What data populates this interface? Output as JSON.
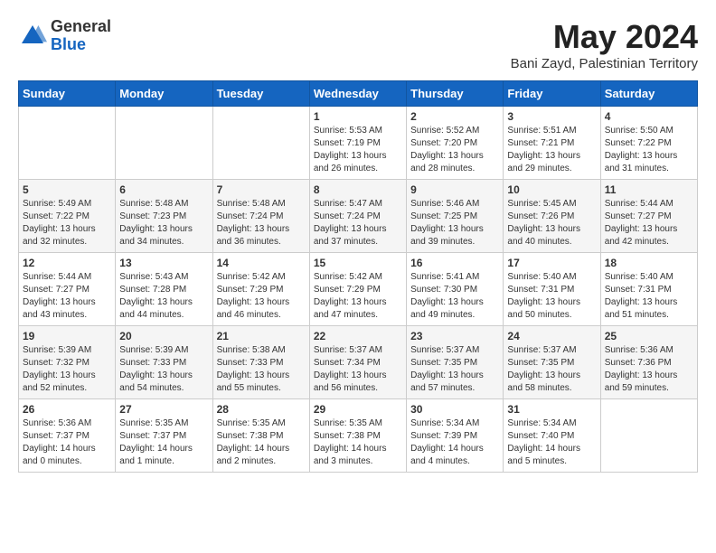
{
  "logo": {
    "general": "General",
    "blue": "Blue"
  },
  "title": "May 2024",
  "location": "Bani Zayd, Palestinian Territory",
  "days_of_week": [
    "Sunday",
    "Monday",
    "Tuesday",
    "Wednesday",
    "Thursday",
    "Friday",
    "Saturday"
  ],
  "weeks": [
    [
      {
        "day": "",
        "info": ""
      },
      {
        "day": "",
        "info": ""
      },
      {
        "day": "",
        "info": ""
      },
      {
        "day": "1",
        "info": "Sunrise: 5:53 AM\nSunset: 7:19 PM\nDaylight: 13 hours\nand 26 minutes."
      },
      {
        "day": "2",
        "info": "Sunrise: 5:52 AM\nSunset: 7:20 PM\nDaylight: 13 hours\nand 28 minutes."
      },
      {
        "day": "3",
        "info": "Sunrise: 5:51 AM\nSunset: 7:21 PM\nDaylight: 13 hours\nand 29 minutes."
      },
      {
        "day": "4",
        "info": "Sunrise: 5:50 AM\nSunset: 7:22 PM\nDaylight: 13 hours\nand 31 minutes."
      }
    ],
    [
      {
        "day": "5",
        "info": "Sunrise: 5:49 AM\nSunset: 7:22 PM\nDaylight: 13 hours\nand 32 minutes."
      },
      {
        "day": "6",
        "info": "Sunrise: 5:48 AM\nSunset: 7:23 PM\nDaylight: 13 hours\nand 34 minutes."
      },
      {
        "day": "7",
        "info": "Sunrise: 5:48 AM\nSunset: 7:24 PM\nDaylight: 13 hours\nand 36 minutes."
      },
      {
        "day": "8",
        "info": "Sunrise: 5:47 AM\nSunset: 7:24 PM\nDaylight: 13 hours\nand 37 minutes."
      },
      {
        "day": "9",
        "info": "Sunrise: 5:46 AM\nSunset: 7:25 PM\nDaylight: 13 hours\nand 39 minutes."
      },
      {
        "day": "10",
        "info": "Sunrise: 5:45 AM\nSunset: 7:26 PM\nDaylight: 13 hours\nand 40 minutes."
      },
      {
        "day": "11",
        "info": "Sunrise: 5:44 AM\nSunset: 7:27 PM\nDaylight: 13 hours\nand 42 minutes."
      }
    ],
    [
      {
        "day": "12",
        "info": "Sunrise: 5:44 AM\nSunset: 7:27 PM\nDaylight: 13 hours\nand 43 minutes."
      },
      {
        "day": "13",
        "info": "Sunrise: 5:43 AM\nSunset: 7:28 PM\nDaylight: 13 hours\nand 44 minutes."
      },
      {
        "day": "14",
        "info": "Sunrise: 5:42 AM\nSunset: 7:29 PM\nDaylight: 13 hours\nand 46 minutes."
      },
      {
        "day": "15",
        "info": "Sunrise: 5:42 AM\nSunset: 7:29 PM\nDaylight: 13 hours\nand 47 minutes."
      },
      {
        "day": "16",
        "info": "Sunrise: 5:41 AM\nSunset: 7:30 PM\nDaylight: 13 hours\nand 49 minutes."
      },
      {
        "day": "17",
        "info": "Sunrise: 5:40 AM\nSunset: 7:31 PM\nDaylight: 13 hours\nand 50 minutes."
      },
      {
        "day": "18",
        "info": "Sunrise: 5:40 AM\nSunset: 7:31 PM\nDaylight: 13 hours\nand 51 minutes."
      }
    ],
    [
      {
        "day": "19",
        "info": "Sunrise: 5:39 AM\nSunset: 7:32 PM\nDaylight: 13 hours\nand 52 minutes."
      },
      {
        "day": "20",
        "info": "Sunrise: 5:39 AM\nSunset: 7:33 PM\nDaylight: 13 hours\nand 54 minutes."
      },
      {
        "day": "21",
        "info": "Sunrise: 5:38 AM\nSunset: 7:33 PM\nDaylight: 13 hours\nand 55 minutes."
      },
      {
        "day": "22",
        "info": "Sunrise: 5:37 AM\nSunset: 7:34 PM\nDaylight: 13 hours\nand 56 minutes."
      },
      {
        "day": "23",
        "info": "Sunrise: 5:37 AM\nSunset: 7:35 PM\nDaylight: 13 hours\nand 57 minutes."
      },
      {
        "day": "24",
        "info": "Sunrise: 5:37 AM\nSunset: 7:35 PM\nDaylight: 13 hours\nand 58 minutes."
      },
      {
        "day": "25",
        "info": "Sunrise: 5:36 AM\nSunset: 7:36 PM\nDaylight: 13 hours\nand 59 minutes."
      }
    ],
    [
      {
        "day": "26",
        "info": "Sunrise: 5:36 AM\nSunset: 7:37 PM\nDaylight: 14 hours\nand 0 minutes."
      },
      {
        "day": "27",
        "info": "Sunrise: 5:35 AM\nSunset: 7:37 PM\nDaylight: 14 hours\nand 1 minute."
      },
      {
        "day": "28",
        "info": "Sunrise: 5:35 AM\nSunset: 7:38 PM\nDaylight: 14 hours\nand 2 minutes."
      },
      {
        "day": "29",
        "info": "Sunrise: 5:35 AM\nSunset: 7:38 PM\nDaylight: 14 hours\nand 3 minutes."
      },
      {
        "day": "30",
        "info": "Sunrise: 5:34 AM\nSunset: 7:39 PM\nDaylight: 14 hours\nand 4 minutes."
      },
      {
        "day": "31",
        "info": "Sunrise: 5:34 AM\nSunset: 7:40 PM\nDaylight: 14 hours\nand 5 minutes."
      },
      {
        "day": "",
        "info": ""
      }
    ]
  ]
}
